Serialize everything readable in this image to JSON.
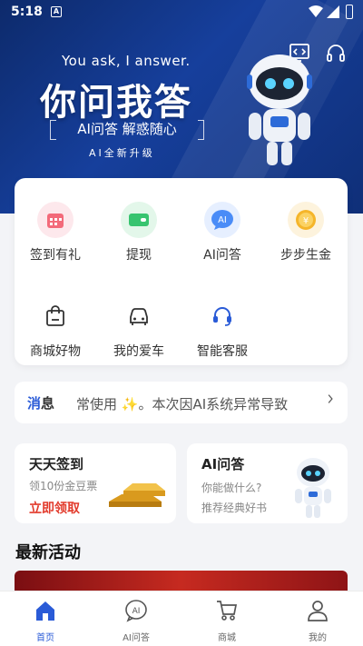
{
  "status_bar": {
    "time": "5:18",
    "app_icon_letter": "A"
  },
  "hero": {
    "tagline": "You ask, I answer.",
    "title": "你问我答",
    "subtitle": "AI问答 解惑随心",
    "upgrade_text": "AI全新升级",
    "background_color": "#163f9c"
  },
  "grid": {
    "items": [
      {
        "label": "签到有礼",
        "icon": "calendar-icon",
        "color": "#f36a7a"
      },
      {
        "label": "提现",
        "icon": "cash-icon",
        "color": "#37c46f"
      },
      {
        "label": "AI问答",
        "icon": "ai-chat-icon",
        "color": "#4a8cf7"
      },
      {
        "label": "步步生金",
        "icon": "coin-icon",
        "color": "#f5b52a"
      },
      {
        "label": "商城好物",
        "icon": "shopping-bag-icon",
        "color": "#333333"
      },
      {
        "label": "我的爱车",
        "icon": "car-icon",
        "color": "#333333"
      },
      {
        "label": "智能客服",
        "icon": "headset-icon",
        "color": "#2a5bd7"
      }
    ]
  },
  "notice": {
    "tag_part1": "消",
    "tag_part2": "息",
    "message": "常使用 ✨。本次因AI系统异常导致"
  },
  "promos": {
    "checkin": {
      "title": "天天签到",
      "subtitle": "领10份金豆票",
      "cta": "立即领取"
    },
    "ai": {
      "title": "AI问答",
      "subtitle1": "你能做什么?",
      "subtitle2": "推荐经典好书"
    }
  },
  "section": {
    "latest_activities": "最新活动"
  },
  "bottom_nav": {
    "items": [
      {
        "label": "首页",
        "icon": "home-icon",
        "active": true
      },
      {
        "label": "AI问答",
        "icon": "ai-chat-icon",
        "active": false
      },
      {
        "label": "商城",
        "icon": "cart-icon",
        "active": false
      },
      {
        "label": "我的",
        "icon": "profile-icon",
        "active": false
      }
    ],
    "active_color": "#2a5bd7"
  }
}
